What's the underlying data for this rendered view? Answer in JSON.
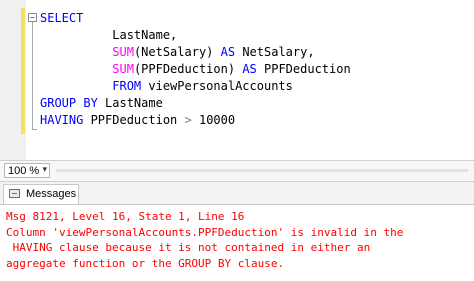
{
  "editor": {
    "line_1": {
      "kw": "SELECT"
    },
    "line_2": {
      "text": "LastName,"
    },
    "line_3": {
      "fn": "SUM",
      "rest": "(NetSalary) ",
      "kw": "AS",
      "alias": " NetSalary,"
    },
    "line_4": {
      "fn": "SUM",
      "rest": "(PPFDeduction) ",
      "kw": "AS",
      "alias": " PPFDeduction"
    },
    "line_5": {
      "kw": "FROM",
      "text": " viewPersonalAccounts"
    },
    "line_6": {
      "kw": "GROUP BY",
      "text": " LastName"
    },
    "line_7": {
      "kw": "HAVING",
      "text": " PPFDeduction ",
      "op": ">",
      "num": " 10000"
    },
    "collapse_glyph": "−"
  },
  "status_bar": {
    "zoom_value": "100 %",
    "zoom_arrow": "▾"
  },
  "results": {
    "tab_label": "Messages",
    "messages": [
      "Msg 8121, Level 16, State 1, Line 16",
      "Column 'viewPersonalAccounts.PPFDeduction' is invalid in the",
      " HAVING clause because it is not contained in either an",
      "aggregate function or the GROUP BY clause."
    ]
  },
  "colors": {
    "keyword": "#0000ff",
    "function": "#ff00ff",
    "operator": "#808080",
    "error_text": "#ff0000",
    "change_bar": "#f5e066"
  }
}
